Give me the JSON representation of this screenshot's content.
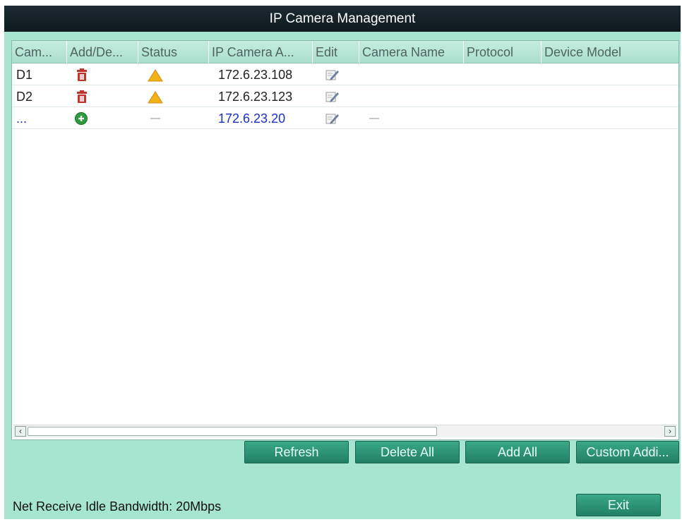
{
  "window": {
    "title": "IP Camera Management"
  },
  "table": {
    "columns": [
      "Cam...",
      "Add/De...",
      "Status",
      "IP Camera A...",
      "Edit",
      "Camera Name",
      "Protocol",
      "Device Model"
    ],
    "rows": [
      {
        "cam": "D1",
        "action_icon": "trash-icon",
        "status_icon": "warning-icon",
        "ip": "172.6.23.108",
        "edit_icon": "edit-icon"
      },
      {
        "cam": "D2",
        "action_icon": "trash-icon",
        "status_icon": "warning-icon",
        "ip": "172.6.23.123",
        "edit_icon": "edit-icon"
      },
      {
        "cam": "...",
        "action_icon": "add-icon",
        "status_icon": "dash",
        "ip": "172.6.23.20",
        "edit_icon": "edit-icon",
        "camera_name": "—"
      }
    ]
  },
  "buttons": {
    "refresh": "Refresh",
    "delete_all": "Delete All",
    "add_all": "Add All",
    "custom_adding": "Custom Addi...",
    "exit": "Exit"
  },
  "footer": {
    "bandwidth": "Net Receive Idle Bandwidth: 20Mbps"
  },
  "colors": {
    "background": "#a6e5cf",
    "titlebar": "#0e1a1f",
    "button": "#2f9a78",
    "trash": "#c0322b",
    "add": "#2f9b3f",
    "warning": "#f2b118",
    "new_ip": "#1a2fc9"
  }
}
